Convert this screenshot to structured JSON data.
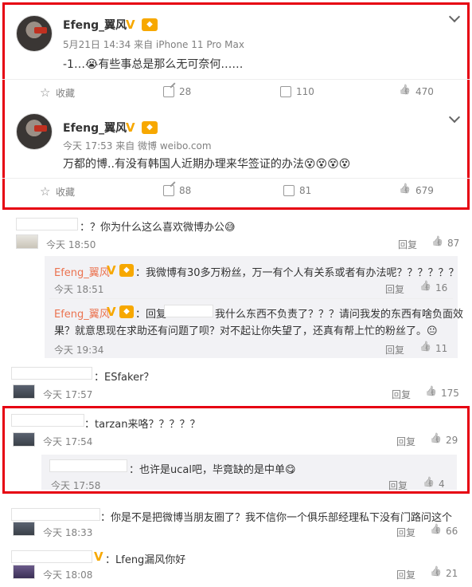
{
  "posts": [
    {
      "username": "Efeng_翼风",
      "meta": "5月21日 14:34 来自 iPhone 11 Pro Max",
      "text": "-1…😭有些事总是那么无可奈何……",
      "actions": {
        "collect": "收藏",
        "repost": "28",
        "comment": "110",
        "like": "470"
      }
    },
    {
      "username": "Efeng_翼风",
      "meta": "今天 17:53 来自 微博 weibo.com",
      "text": "万都的博..有没有韩国人近期办理来华签证的办法😵😵😵😵",
      "actions": {
        "collect": "收藏",
        "repost": "88",
        "comment": "81",
        "like": "679"
      }
    }
  ],
  "comments": [
    {
      "text": "：？你为什么这么喜欢微博办公😅",
      "time": "今天 18:50",
      "reply": "回复",
      "likes": "87",
      "subs": [
        {
          "user": "Efeng_翼风",
          "text": "：我微博有30多万粉丝，万一有个人有关系或者有办法呢？？？？？？",
          "time": "今天 18:51",
          "reply": "回复",
          "likes": "16"
        },
        {
          "user": "Efeng_翼风",
          "text1": "：回复",
          "text2": "我什么东西不负责了？？？请问我发的东西有啥负面效",
          "text3": "果？就意思现在求助还有问题了呗？对不起让你失望了，还真有帮上忙的粉丝了。😐",
          "time": "今天 19:34",
          "reply": "回复",
          "likes": "11"
        }
      ]
    },
    {
      "text": "：ESfaker？",
      "time": "今天 17:57",
      "reply": "回复",
      "likes": "175"
    },
    {
      "text": "：tarzan来咯？？？？？",
      "time": "今天 17:54",
      "reply": "回复",
      "likes": "29",
      "subs": [
        {
          "text": "：也许是ucal吧，毕竟缺的是中单😋",
          "time": "今天 17:58",
          "reply": "回复",
          "likes": "4"
        }
      ]
    },
    {
      "text": "：你是不是把微博当朋友圈了？我不信你一个俱乐部经理私下没有门路问这个",
      "time": "今天 18:33",
      "reply": "回复",
      "likes": "66"
    },
    {
      "text": "：Lfeng漏风你好",
      "time": "今天 18:08",
      "reply": "回复",
      "likes": "21"
    }
  ]
}
